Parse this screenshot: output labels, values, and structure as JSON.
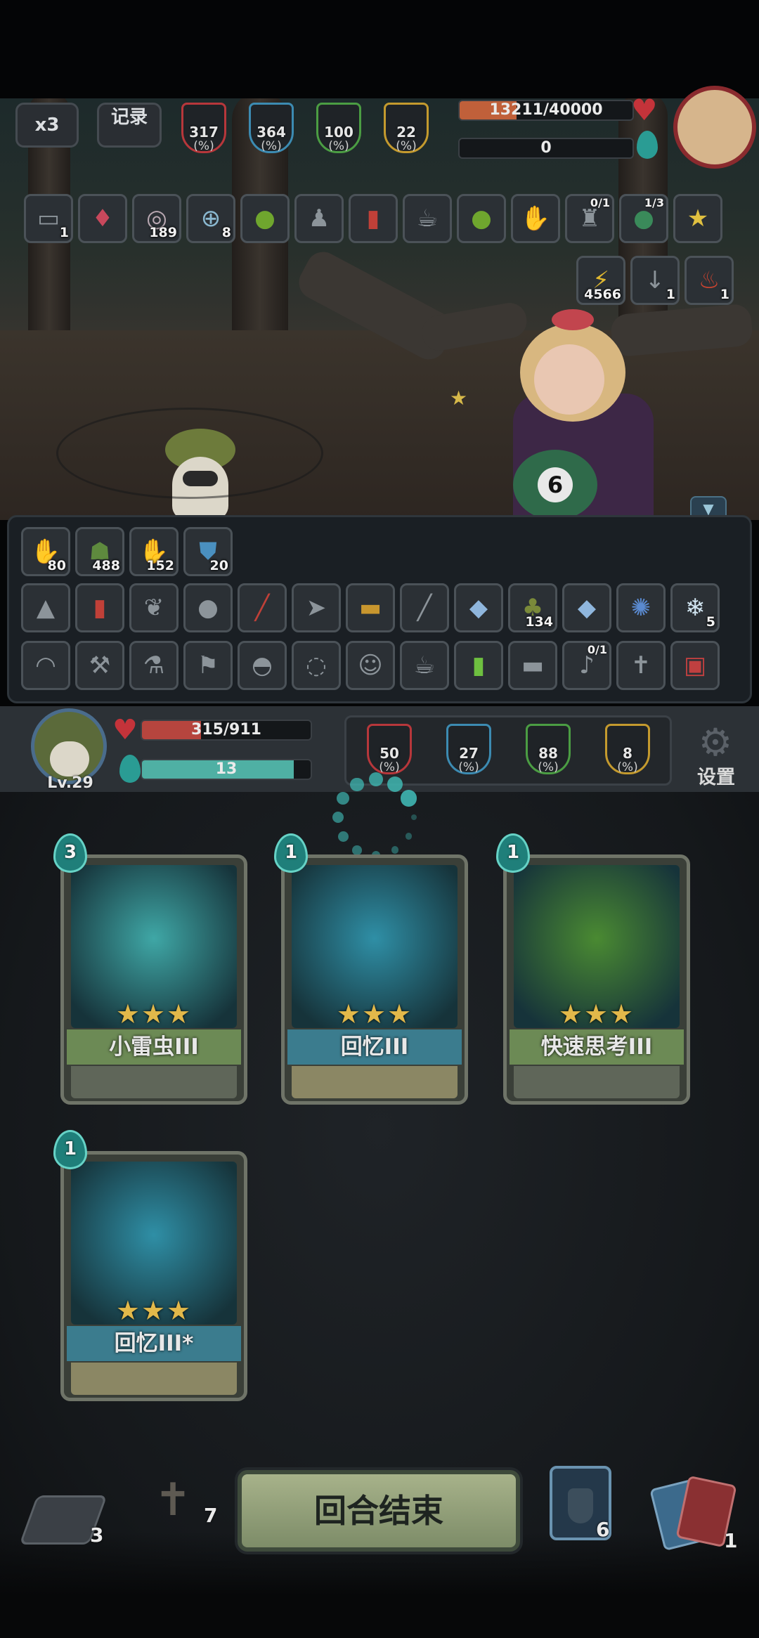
{
  "hud": {
    "speed_label": "x3",
    "log_label": "记录",
    "enemy_stats": [
      {
        "value": "317",
        "unit": "(%)",
        "color": "#b7373b",
        "icon": "attack-icon"
      },
      {
        "value": "364",
        "unit": "(%)",
        "color": "#3c8bb2",
        "icon": "mystery-icon"
      },
      {
        "value": "100",
        "unit": "(%)",
        "color": "#4b9d43",
        "icon": "defense-icon"
      },
      {
        "value": "22",
        "unit": "(%)",
        "color": "#c49a2e",
        "icon": "speed-icon"
      }
    ],
    "enemy_hp_text": "13211/40000",
    "enemy_hp_fraction": 0.33,
    "enemy_mana_text": "0",
    "enemy_buffs": [
      {
        "icon": "cards-icon",
        "count": "1",
        "top": ""
      },
      {
        "icon": "crystal-heart-icon",
        "count": "",
        "top": ""
      },
      {
        "icon": "spiral-icon",
        "count": "189",
        "top": ""
      },
      {
        "icon": "target-icon",
        "count": "8",
        "top": ""
      },
      {
        "icon": "green-orb-icon",
        "count": "",
        "top": ""
      },
      {
        "icon": "figure-icon",
        "count": "",
        "top": ""
      },
      {
        "icon": "firecracker-icon",
        "count": "",
        "top": ""
      },
      {
        "icon": "teacup-icon",
        "count": "",
        "top": ""
      },
      {
        "icon": "green-slime-icon",
        "count": "",
        "top": ""
      },
      {
        "icon": "glove-icon",
        "count": "",
        "top": ""
      },
      {
        "icon": "lantern-icon",
        "count": "",
        "top": "0/1"
      },
      {
        "icon": "billiard-ball-icon",
        "count": "",
        "top": "1/3"
      },
      {
        "icon": "star-icon",
        "count": "",
        "top": ""
      }
    ],
    "enemy_status": [
      {
        "icon": "lightning-icon",
        "count": "4566"
      },
      {
        "icon": "down-arrow-icon",
        "count": "1"
      },
      {
        "icon": "flame-drop-icon",
        "count": "1"
      }
    ]
  },
  "panel": {
    "statuses": [
      {
        "icon": "dark-hand-icon",
        "count": "80"
      },
      {
        "icon": "green-ghost-icon",
        "count": "488"
      },
      {
        "icon": "purple-hand-icon",
        "count": "152"
      },
      {
        "icon": "shield-icon",
        "count": "20"
      }
    ],
    "row1": [
      {
        "icon": "rice-ball-icon",
        "count": "",
        "top": ""
      },
      {
        "icon": "firecracker-icon",
        "count": "",
        "top": ""
      },
      {
        "icon": "wings-icon",
        "count": "",
        "top": ""
      },
      {
        "icon": "bomb-icon",
        "count": "",
        "top": ""
      },
      {
        "icon": "red-stick-icon",
        "count": "",
        "top": ""
      },
      {
        "icon": "fish-icon",
        "count": "",
        "top": ""
      },
      {
        "icon": "bread-icon",
        "count": "",
        "top": ""
      },
      {
        "icon": "bone-icon",
        "count": "",
        "top": ""
      },
      {
        "icon": "ice-crystal-icon",
        "count": "",
        "top": ""
      },
      {
        "icon": "swamp-icon",
        "count": "134",
        "top": ""
      },
      {
        "icon": "ice-gem-icon",
        "count": "",
        "top": ""
      },
      {
        "icon": "storm-icon",
        "count": "",
        "top": ""
      },
      {
        "icon": "snowflake-icon",
        "count": "5",
        "top": ""
      }
    ],
    "row2": [
      {
        "icon": "wreath-icon",
        "count": "",
        "top": ""
      },
      {
        "icon": "axe-icon",
        "count": "",
        "top": ""
      },
      {
        "icon": "potions-icon",
        "count": "",
        "top": ""
      },
      {
        "icon": "runner-icon",
        "count": "",
        "top": ""
      },
      {
        "icon": "helmet-icon",
        "count": "",
        "top": ""
      },
      {
        "icon": "swirl-icon",
        "count": "",
        "top": ""
      },
      {
        "icon": "doll-icon",
        "count": "",
        "top": ""
      },
      {
        "icon": "teacup-icon",
        "count": "",
        "top": ""
      },
      {
        "icon": "green-potion-icon",
        "count": "",
        "top": ""
      },
      {
        "icon": "log-icon",
        "count": "",
        "top": ""
      },
      {
        "icon": "rattle-icon",
        "count": "",
        "top": "0/1"
      },
      {
        "icon": "cross-icon",
        "count": "",
        "top": ""
      },
      {
        "icon": "red-book-icon",
        "count": "",
        "top": ""
      }
    ]
  },
  "player": {
    "level": "Lv.29",
    "hp_text": "315/911",
    "hp_fraction": 0.35,
    "mana_text": "13",
    "mana_fraction": 0.9,
    "stats": [
      {
        "value": "50",
        "unit": "(%)",
        "color": "#b7373b",
        "icon": "attack-icon"
      },
      {
        "value": "27",
        "unit": "(%)",
        "color": "#3c8bb2",
        "icon": "mystery-icon"
      },
      {
        "value": "88",
        "unit": "(%)",
        "color": "#4b9d43",
        "icon": "defense-icon"
      },
      {
        "value": "8",
        "unit": "(%)",
        "color": "#c49a2e",
        "icon": "speed-icon"
      }
    ],
    "settings_label": "设置"
  },
  "cards": [
    {
      "name": "小雷虫III",
      "cost": "3",
      "stars": "★★★",
      "art": "#3fa7a6",
      "bar": "#6c8a55",
      "foot": "#5f6659",
      "icon": "thunder-bug-icon"
    },
    {
      "name": "回忆III",
      "cost": "1",
      "stars": "★★★",
      "art": "#2f8fa6",
      "bar": "#3b7c8e",
      "foot": "#8b8764",
      "icon": "memory-icon"
    },
    {
      "name": "快速思考III",
      "cost": "1",
      "stars": "★★★",
      "art": "#4a8a32",
      "bar": "#6c8a55",
      "foot": "#5f6659",
      "icon": "quick-think-icon"
    },
    {
      "name": "回忆III*",
      "cost": "1",
      "stars": "★★★",
      "art": "#2f8fa6",
      "bar": "#3b7c8e",
      "foot": "#8b8764",
      "icon": "memory-icon"
    }
  ],
  "bottom": {
    "draw_pile_count": "3",
    "grave_count": "7",
    "end_turn_label": "回合结束",
    "potion_count": "6",
    "discard_count": "1"
  }
}
